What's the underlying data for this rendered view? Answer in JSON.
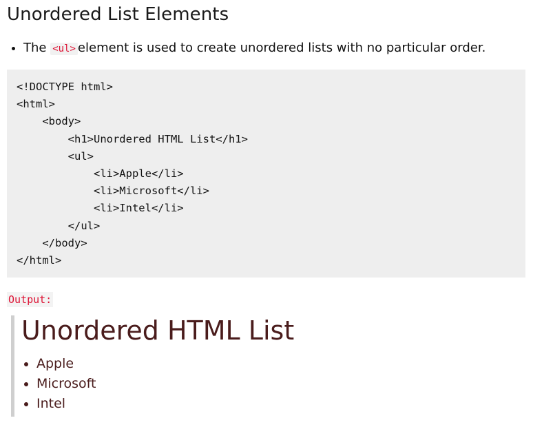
{
  "section": {
    "title": "Unordered List Elements"
  },
  "description": {
    "prefix": "The ",
    "code": "<ul>",
    "suffix": "element is used to create unordered lists with no particular order."
  },
  "code_block": {
    "lines": [
      "<!DOCTYPE html>",
      "<html>",
      "    <body>",
      "        <h1>Unordered HTML List</h1>",
      "        <ul>",
      "            <li>Apple</li>",
      "            <li>Microsoft</li>",
      "            <li>Intel</li>",
      "        </ul>",
      "    </body>",
      "</html>"
    ]
  },
  "output": {
    "label": "Output:",
    "heading": "Unordered HTML List",
    "items": [
      "Apple",
      "Microsoft",
      "Intel"
    ]
  },
  "colors": {
    "code_accent": "#dd1133",
    "code_background": "#eeeeee",
    "output_text": "#4a1c1c",
    "output_border": "#cfcfcf"
  }
}
